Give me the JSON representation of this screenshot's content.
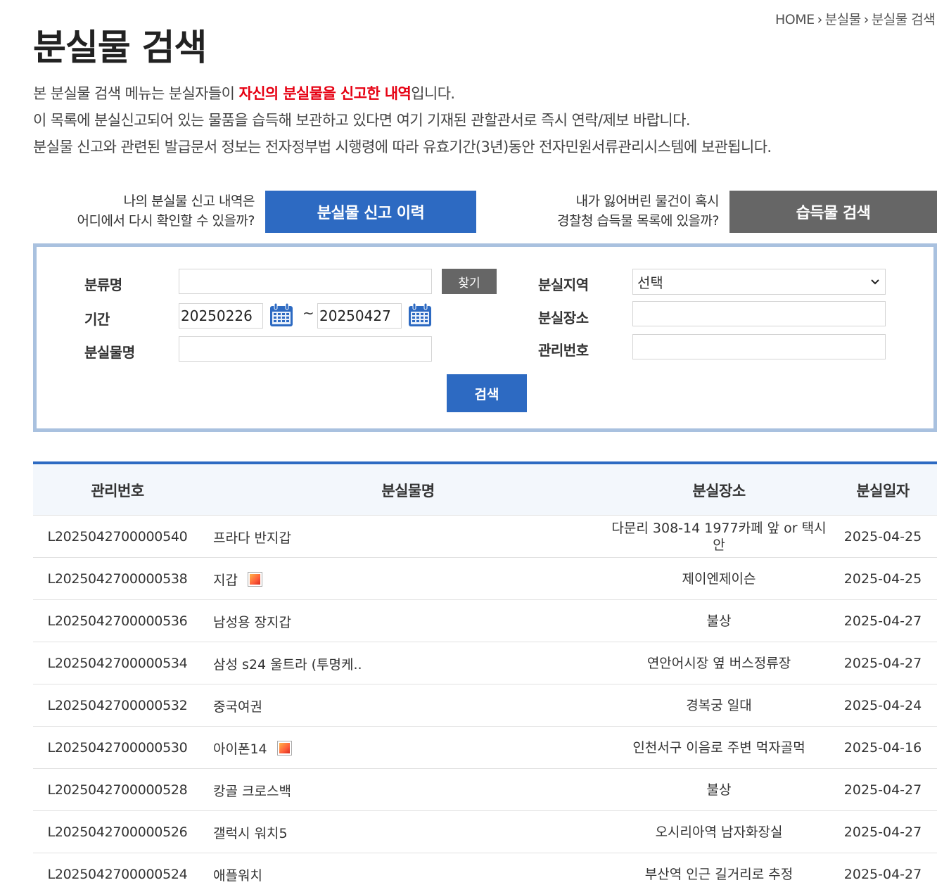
{
  "breadcrumb": {
    "home": "HOME",
    "level1": "분실물",
    "level2": "분실물 검색"
  },
  "page_title": "분실물 검색",
  "intro": {
    "line1_prefix": "본 분실물 검색 메뉴는 분실자들이 ",
    "line1_highlight": "자신의 분실물을 신고한 내역",
    "line1_suffix": "입니다.",
    "line2": "이 목록에 분실신고되어 있는 물품을 습득해 보관하고 있다면 여기 기재된 관할관서로 즉시 연락/제보 바랍니다.",
    "line3": "분실물 신고와 관련된 발급문서 정보는 전자정부법 시행령에 따라 유효기간(3년)동안 전자민원서류관리시스템에 보관됩니다."
  },
  "promos": {
    "history": {
      "text1": "나의 분실물 신고 내역은",
      "text2": "어디에서 다시 확인할 수 있을까?",
      "button": "분실물 신고 이력"
    },
    "found": {
      "text1": "내가 잃어버린 물건이 혹시",
      "text2": "경찰청 습득물 목록에 있을까?",
      "button": "습득물 검색"
    }
  },
  "search_form": {
    "category_label": "분류명",
    "category_value": "",
    "find_button": "찾기",
    "period_label": "기간",
    "date_from": "20250226",
    "date_separator": "~",
    "date_to": "20250427",
    "item_name_label": "분실물명",
    "item_name_value": "",
    "region_label": "분실지역",
    "region_selected": "선택",
    "place_label": "분실장소",
    "place_value": "",
    "mgmt_no_label": "관리번호",
    "mgmt_no_value": "",
    "search_button": "검색"
  },
  "table": {
    "headers": {
      "no": "관리번호",
      "name": "분실물명",
      "place": "분실장소",
      "date": "분실일자"
    },
    "rows": [
      {
        "no": "L2025042700000540",
        "name": "프라다 반지갑",
        "has_image": false,
        "place": "다문리 308-14 1977카페 앞 or 택시안",
        "date": "2025-04-25"
      },
      {
        "no": "L2025042700000538",
        "name": "지갑",
        "has_image": true,
        "place": "제이엔제이슨",
        "date": "2025-04-25"
      },
      {
        "no": "L2025042700000536",
        "name": "남성용 장지갑",
        "has_image": false,
        "place": "불상",
        "date": "2025-04-27"
      },
      {
        "no": "L2025042700000534",
        "name": "삼성 s24 울트라 (투명케..",
        "has_image": false,
        "place": "연안어시장 옆 버스정류장",
        "date": "2025-04-27"
      },
      {
        "no": "L2025042700000532",
        "name": "중국여권",
        "has_image": false,
        "place": "경복궁 일대",
        "date": "2025-04-24"
      },
      {
        "no": "L2025042700000530",
        "name": "아이폰14",
        "has_image": true,
        "place": "인천서구 이음로 주변 먹자골먹",
        "date": "2025-04-16"
      },
      {
        "no": "L2025042700000528",
        "name": "캉골 크로스백",
        "has_image": false,
        "place": "불상",
        "date": "2025-04-27"
      },
      {
        "no": "L2025042700000526",
        "name": "갤럭시 워치5",
        "has_image": false,
        "place": "오시리아역 남자화장실",
        "date": "2025-04-27"
      },
      {
        "no": "L2025042700000524",
        "name": "애플워치",
        "has_image": false,
        "place": "부산역 인근 길거리로 추정",
        "date": "2025-04-27"
      }
    ]
  }
}
